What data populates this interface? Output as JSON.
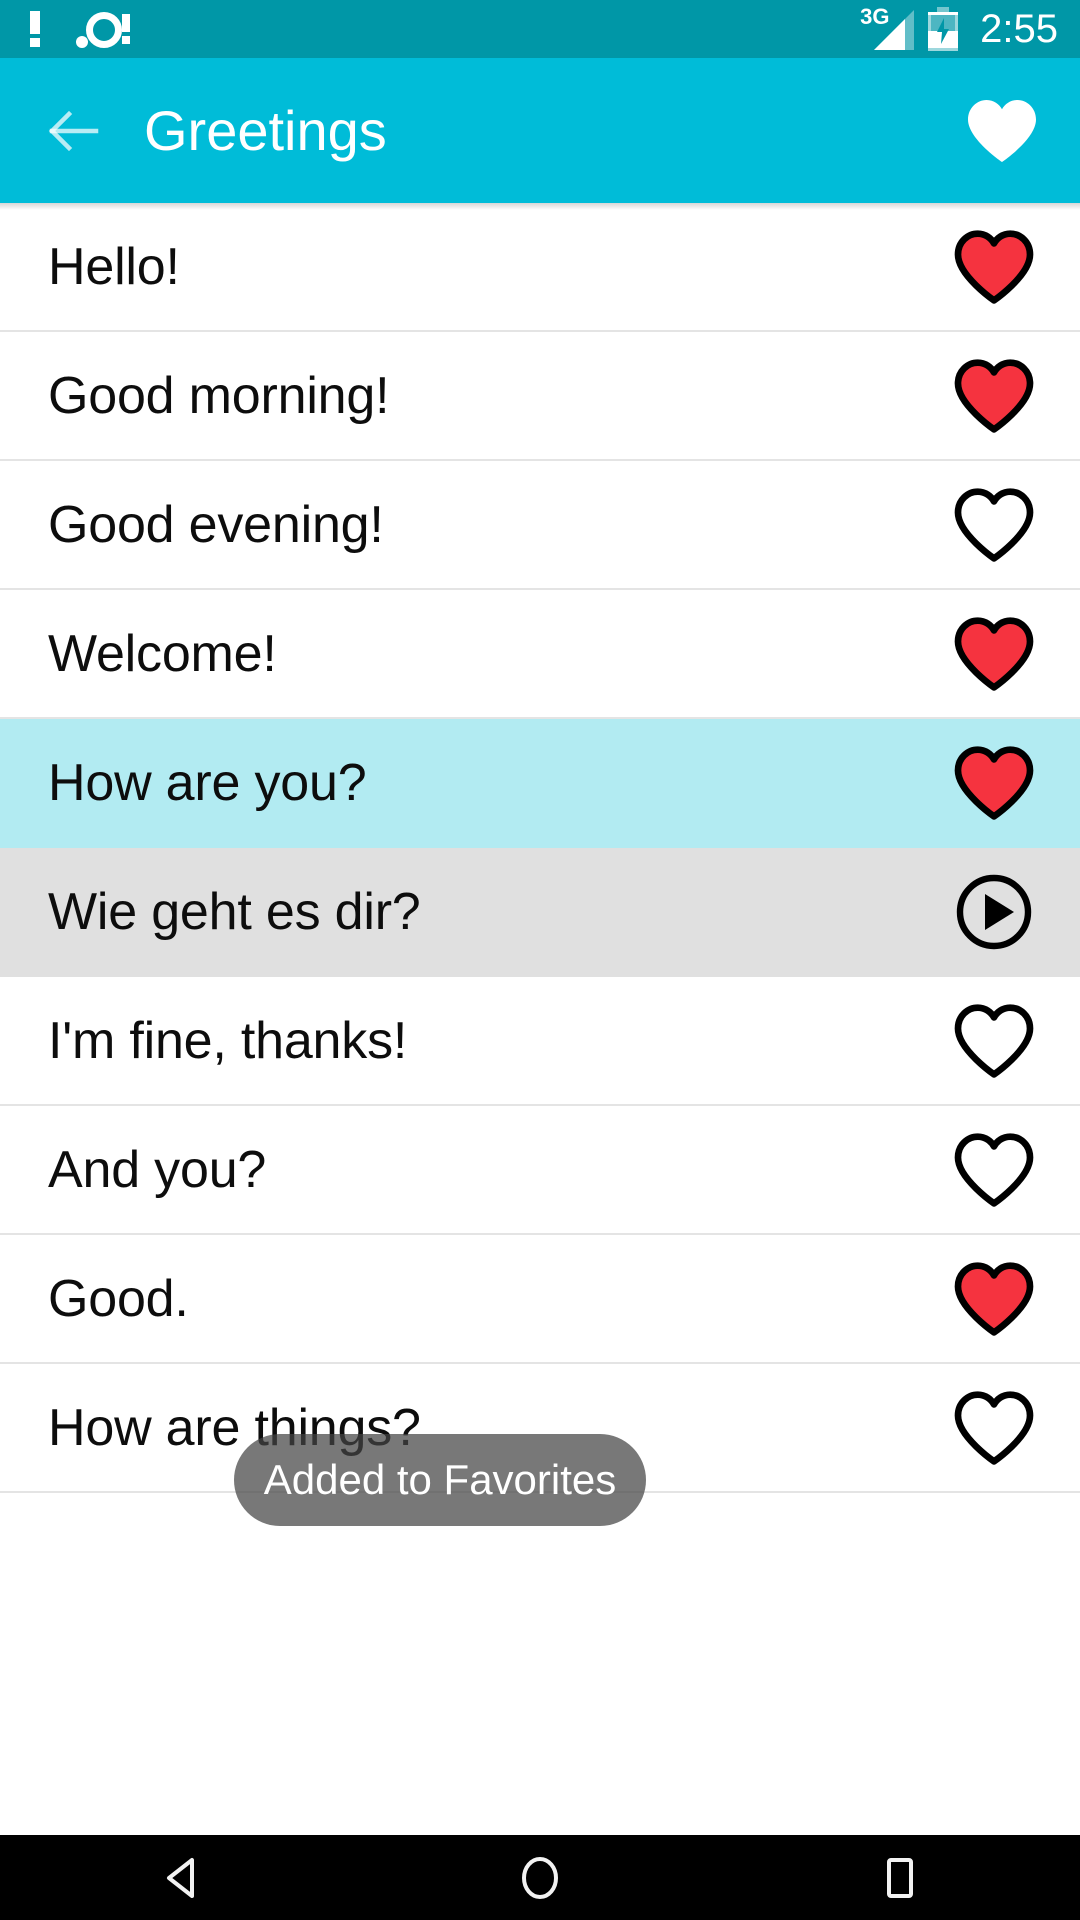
{
  "status_bar": {
    "background_color": "#0097a7",
    "left_icons": [
      {
        "name": "alert-exclamation-icon",
        "glyph": "!"
      },
      {
        "name": "sync-alert-icon",
        "glyph": "circle-bang"
      }
    ],
    "network_type": "3G",
    "battery_state": "charging",
    "clock": "2:55"
  },
  "app_bar": {
    "background_color": "#00bcd8",
    "back_label": "back-arrow",
    "title": "Greetings",
    "favorites_label": "favorites-heart"
  },
  "list": {
    "rows": [
      {
        "label": "Hello!",
        "action": "heart",
        "favorite": true,
        "state": "normal"
      },
      {
        "label": "Good morning!",
        "action": "heart",
        "favorite": true,
        "state": "normal"
      },
      {
        "label": "Good evening!",
        "action": "heart",
        "favorite": false,
        "state": "normal"
      },
      {
        "label": "Welcome!",
        "action": "heart",
        "favorite": true,
        "state": "normal"
      },
      {
        "label": "How are you?",
        "action": "heart",
        "favorite": true,
        "state": "selected"
      },
      {
        "label": "Wie geht es dir?",
        "action": "play",
        "favorite": false,
        "state": "playing"
      },
      {
        "label": "I'm fine, thanks!",
        "action": "heart",
        "favorite": false,
        "state": "normal"
      },
      {
        "label": "And you?",
        "action": "heart",
        "favorite": false,
        "state": "normal"
      },
      {
        "label": "Good.",
        "action": "heart",
        "favorite": true,
        "state": "normal"
      },
      {
        "label": "How are things?",
        "action": "heart",
        "favorite": false,
        "state": "normal"
      }
    ],
    "colors": {
      "selected_row": "#b2ebf2",
      "playing_row": "#e0e0e0",
      "favorite_fill": "#f5333f",
      "outline": "#000000",
      "divider": "#e4e4e4"
    }
  },
  "toast": {
    "message": "Added to Favorites",
    "background_color": "rgba(68,68,68,0.72)"
  },
  "nav_bar": {
    "background_color": "#000000",
    "buttons": [
      {
        "name": "nav-back-button",
        "icon": "triangle-left-icon"
      },
      {
        "name": "nav-home-button",
        "icon": "circle-icon"
      },
      {
        "name": "nav-recents-button",
        "icon": "square-icon"
      }
    ]
  }
}
